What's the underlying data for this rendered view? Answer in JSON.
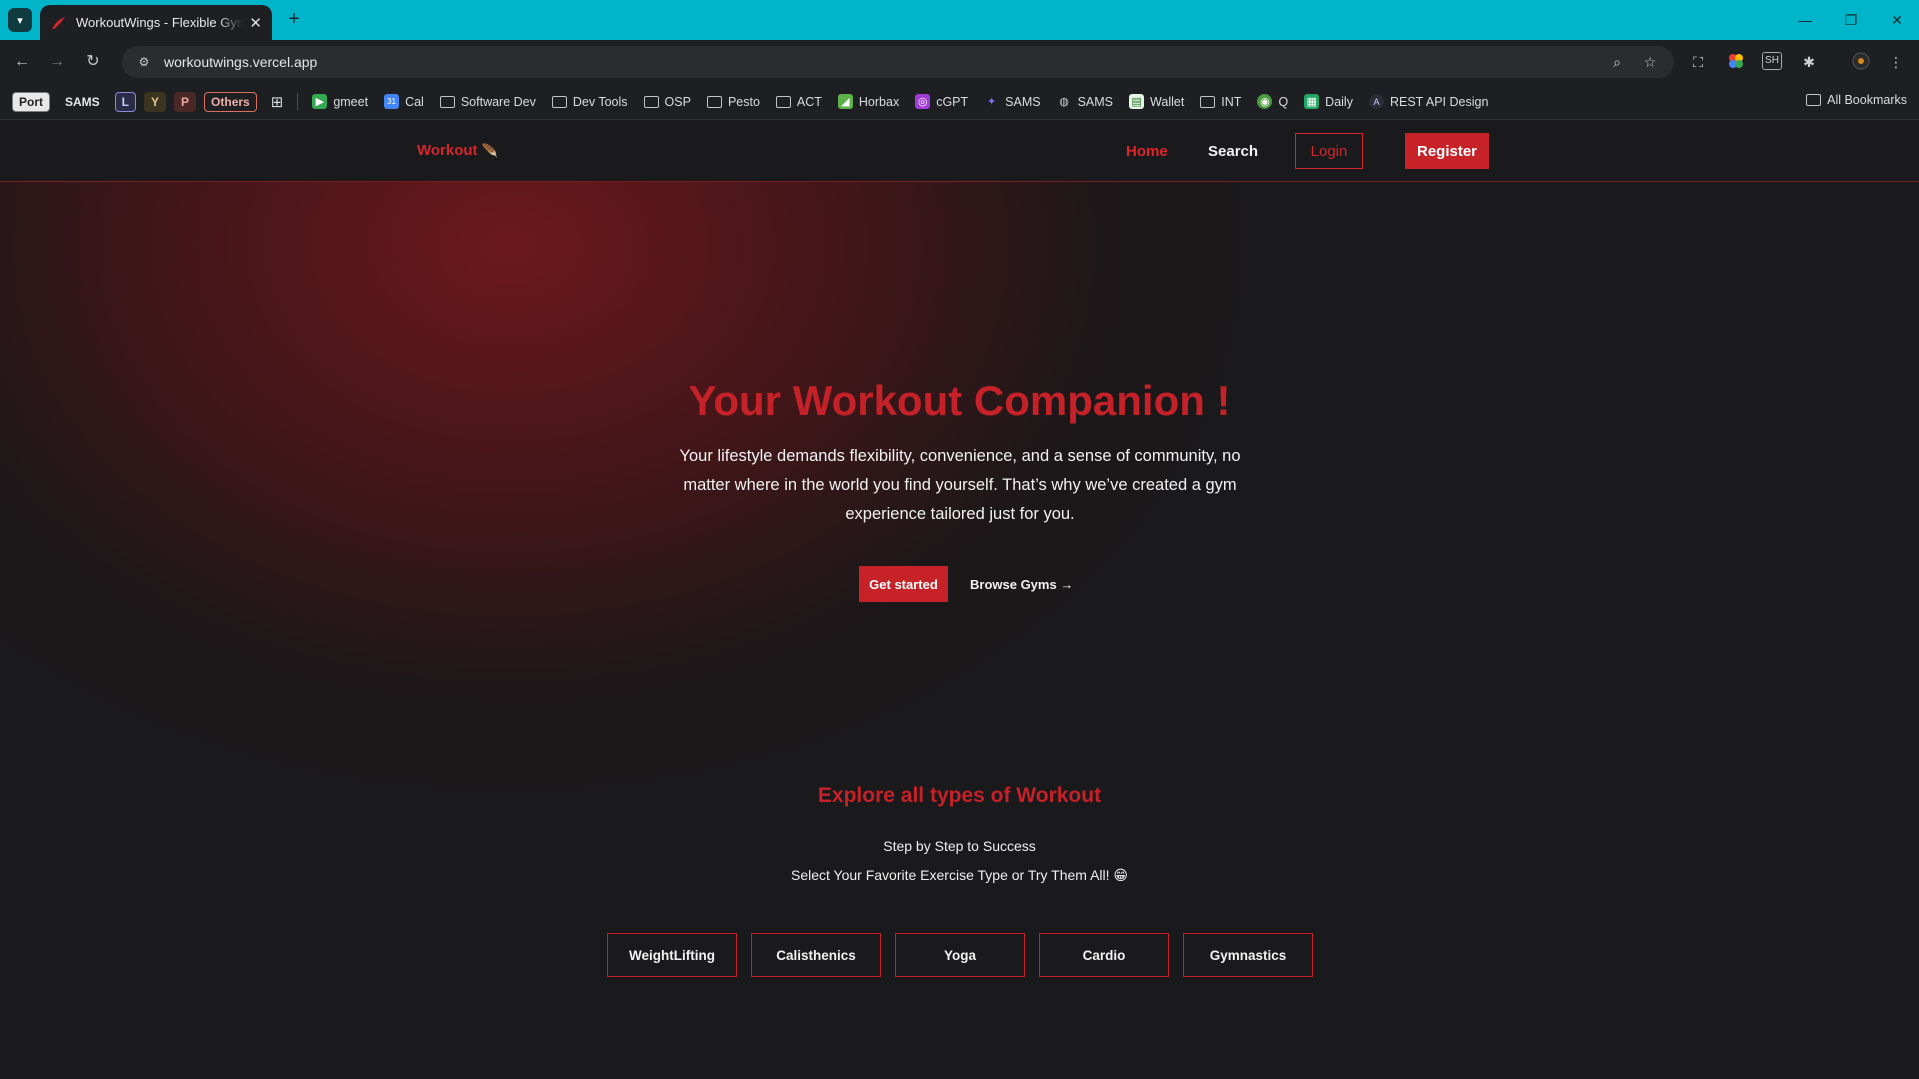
{
  "browser": {
    "tab_title": "WorkoutWings - Flexible Gym B",
    "url": "workoutwings.vercel.app",
    "bookmark_chips": [
      "Port",
      "SAMS",
      "L",
      "Y",
      "P",
      "Others"
    ],
    "bookmarks": [
      {
        "label": "gmeet",
        "icon": "google-meet-icon"
      },
      {
        "label": "Cal",
        "icon": "calendar-icon"
      },
      {
        "label": "Software Dev",
        "icon": "folder-icon"
      },
      {
        "label": "Dev Tools",
        "icon": "folder-icon"
      },
      {
        "label": "OSP",
        "icon": "folder-icon"
      },
      {
        "label": "Pesto",
        "icon": "folder-icon"
      },
      {
        "label": "ACT",
        "icon": "folder-icon"
      },
      {
        "label": "Horbax",
        "icon": "horbax-icon"
      },
      {
        "label": "cGPT",
        "icon": "chatgpt-icon"
      },
      {
        "label": "SAMS",
        "icon": "sams-icon"
      },
      {
        "label": "SAMS",
        "icon": "globe-icon"
      },
      {
        "label": "Wallet",
        "icon": "wallet-icon"
      },
      {
        "label": "INT",
        "icon": "folder-icon"
      },
      {
        "label": "Q",
        "icon": "q-icon"
      },
      {
        "label": "Daily",
        "icon": "sheets-icon"
      },
      {
        "label": "REST API Design",
        "icon": "api-icon"
      }
    ],
    "all_bookmarks": "All Bookmarks"
  },
  "site": {
    "brand": "Workout",
    "nav": {
      "home": "Home",
      "search": "Search",
      "login": "Login",
      "register": "Register"
    },
    "hero": {
      "title": "Your Workout Companion !",
      "subtitle": "Your lifestyle demands flexibility, convenience, and a sense of community, no matter where in the world you find yourself. That’s why we’ve created a gym experience tailored just for you.",
      "cta_primary": "Get started",
      "cta_secondary": "Browse Gyms →"
    },
    "explore": {
      "title": "Explore all types of Workout",
      "line1": "Step by Step to Success",
      "line2": "Select Your Favorite Exercise Type or Try Them All! 😁",
      "types": [
        "WeightLifting",
        "Calisthenics",
        "Yoga",
        "Cardio",
        "Gymnastics"
      ]
    }
  },
  "colors": {
    "accent": "#c42128",
    "background": "#1a191b",
    "titlebar": "#00b5c9"
  }
}
